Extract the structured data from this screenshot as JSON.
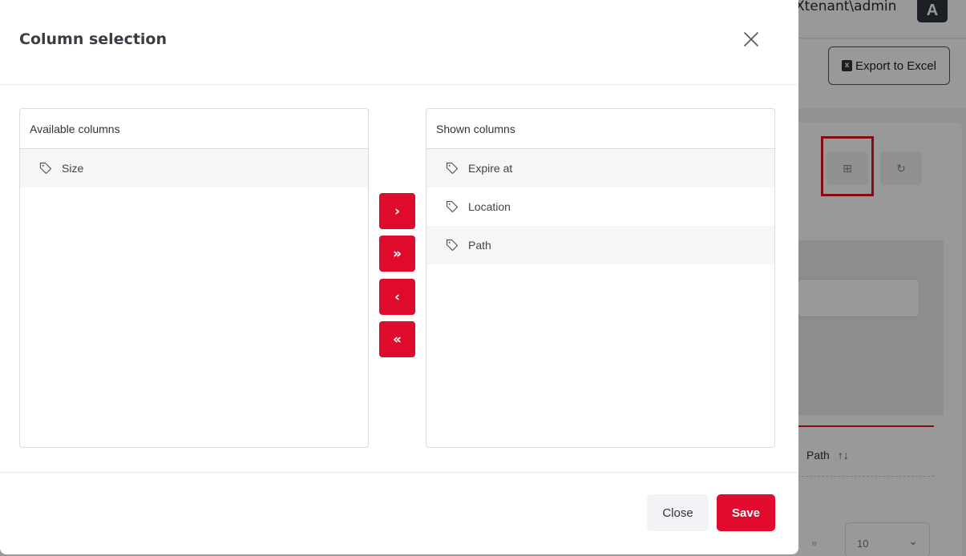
{
  "background": {
    "user_label": "Xtenant\\admin",
    "avatar_initial": "A",
    "export_button_label": "Export to Excel",
    "export_icon_glyph": "x",
    "column_header_path": "Path",
    "sort_glyph": "↑↓",
    "pager_next_glyph": "»",
    "page_size_value": "10",
    "page_size_chevron": "⌄",
    "column_select_icon": "⊞",
    "refresh_icon": "↻"
  },
  "modal": {
    "title": "Column selection",
    "available": {
      "header": "Available columns",
      "items": [
        {
          "label": "Size"
        }
      ]
    },
    "shown": {
      "header": "Shown columns",
      "items": [
        {
          "label": "Expire at"
        },
        {
          "label": "Location"
        },
        {
          "label": "Path"
        }
      ]
    },
    "move_buttons": {
      "move_right": "›",
      "move_all_right": "»",
      "move_left": "‹",
      "move_all_left": "«"
    },
    "footer": {
      "close_label": "Close",
      "save_label": "Save"
    }
  },
  "colors": {
    "accent_red": "#df0a2c",
    "title_text": "#3a3d44"
  }
}
